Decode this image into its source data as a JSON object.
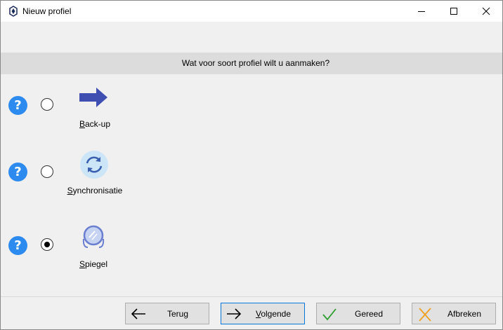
{
  "window": {
    "title": "Nieuw profiel",
    "controls": [
      "minimize-icon",
      "maximize-icon",
      "close-icon"
    ]
  },
  "header": {
    "question": "Wat voor soort profiel wilt u aanmaken?"
  },
  "options": [
    {
      "label": "Back-up",
      "icon": "arrow-right-icon",
      "selected": false,
      "help_glyph": "?"
    },
    {
      "label": "Synchronisatie",
      "icon": "sync-icon",
      "selected": false,
      "help_glyph": "?"
    },
    {
      "label": "Spiegel",
      "icon": "mirror-icon",
      "selected": true,
      "help_glyph": "?"
    }
  ],
  "buttons": {
    "back": {
      "label": "Terug",
      "icon": "arrow-left-icon"
    },
    "next": {
      "label": "Volgende",
      "icon": "arrow-right-icon"
    },
    "finish": {
      "label": "Gereed",
      "icon": "checkmark-icon"
    },
    "cancel": {
      "label": "Afbreken",
      "icon": "cross-icon"
    }
  },
  "colors": {
    "help_blue": "#2d8bef",
    "arrow_blue": "#3f4fb1",
    "check_green": "#2e9e2e",
    "cancel_orange": "#f0a020",
    "header_band": "#dcdcdc"
  }
}
